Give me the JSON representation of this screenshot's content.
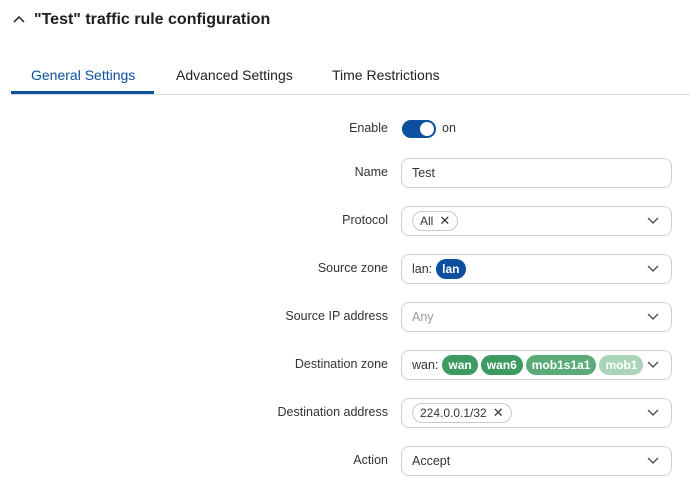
{
  "header": {
    "title": "\"Test\" traffic rule configuration",
    "collapse_icon": "chevron-up-icon"
  },
  "tabs": [
    {
      "label": "General Settings",
      "active": true
    },
    {
      "label": "Advanced Settings",
      "active": false
    },
    {
      "label": "Time Restrictions",
      "active": false
    }
  ],
  "form": {
    "enable": {
      "label": "Enable",
      "state_text": "on",
      "value": true
    },
    "name": {
      "label": "Name",
      "value": "Test"
    },
    "protocol": {
      "label": "Protocol",
      "chip": "All",
      "remove_icon": "close-icon"
    },
    "source_zone": {
      "label": "Source zone",
      "prefix": "lan:",
      "chip": "lan"
    },
    "source_ip": {
      "label": "Source IP address",
      "placeholder": "Any"
    },
    "destination_zone": {
      "label": "Destination zone",
      "prefix": "wan:",
      "chips": [
        "wan",
        "wan6",
        "mob1s1a1",
        "mob1"
      ]
    },
    "destination_address": {
      "label": "Destination address",
      "chip": "224.0.0.1/32",
      "remove_icon": "close-icon"
    },
    "action": {
      "label": "Action",
      "value": "Accept"
    }
  },
  "colors": {
    "accent": "#0b4f9e",
    "zone_green": "#3d9a60",
    "zone_green_faded": "#8fc6a3"
  }
}
